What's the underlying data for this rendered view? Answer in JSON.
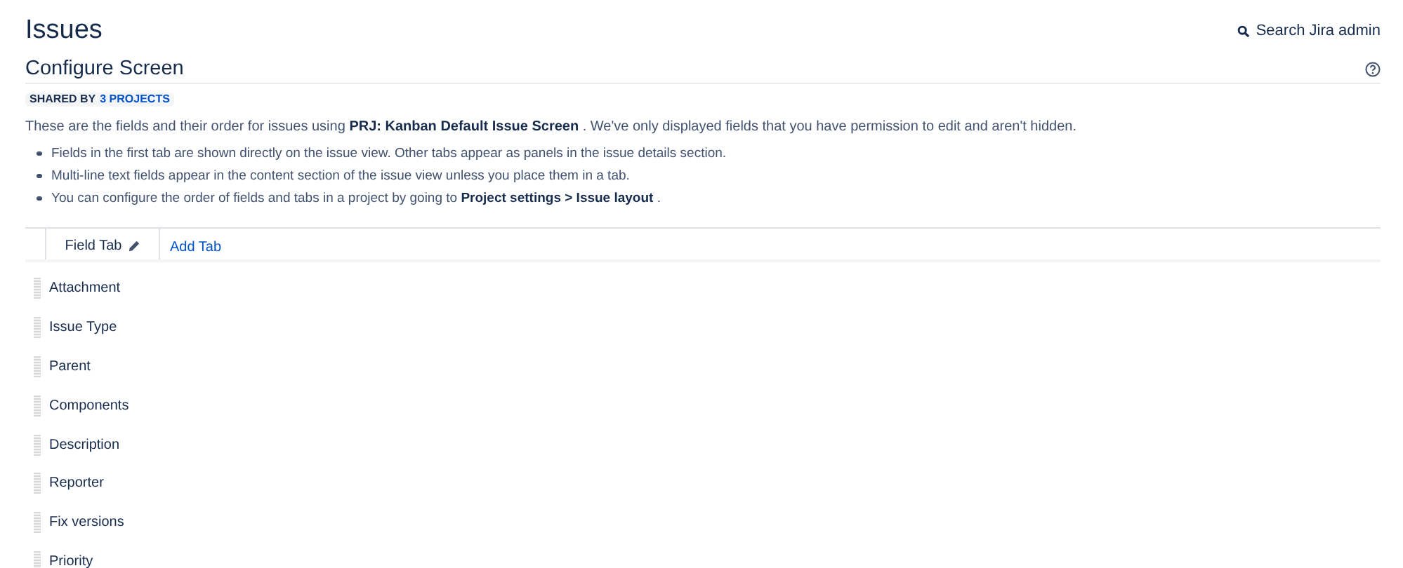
{
  "page_title": "Issues",
  "search": {
    "label": "Search Jira admin"
  },
  "section_title": "Configure Screen",
  "shared": {
    "label": "SHARED BY",
    "link": "3 PROJECTS"
  },
  "intro": "These are the fields and their order for issues using **PRJ: Kanban Default Issue Screen** . We've only displayed fields that you have permission to edit and aren't hidden.",
  "bullets": [
    "Fields in the first tab are shown directly on the issue view. Other tabs appear as panels in the issue details section.",
    "Multi-line text fields appear in the content section of the issue view unless you place them in a tab.",
    "You can configure the order of fields and tabs in a project by going to **Project settings > Issue layout** ."
  ],
  "tabs": [
    {
      "label": "Field Tab",
      "selected": true,
      "editable": true
    }
  ],
  "add_tab": "Add Tab",
  "fields": [
    "Attachment",
    "Issue Type",
    "Parent",
    "Components",
    "Description",
    "Reporter",
    "Fix versions",
    "Priority"
  ]
}
